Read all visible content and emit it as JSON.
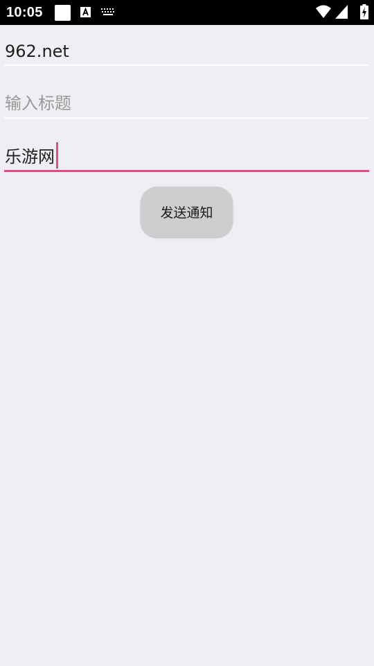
{
  "status_bar": {
    "time": "10:05",
    "notification_icons": [
      "square-icon",
      "text-a-icon",
      "keyboard-icon"
    ],
    "system_icons": [
      "wifi-icon",
      "signal-icon",
      "battery-charging-icon"
    ]
  },
  "form": {
    "url_field": {
      "value": "962.net",
      "placeholder": ""
    },
    "title_field": {
      "value": "",
      "placeholder": "输入标题"
    },
    "content_field": {
      "value": "乐游网",
      "focused": true
    },
    "send_button_label": "发送通知"
  },
  "colors": {
    "accent": "#e54b82",
    "background": "#efeef3",
    "button": "#cfcdcd",
    "status_bar": "#000000"
  }
}
